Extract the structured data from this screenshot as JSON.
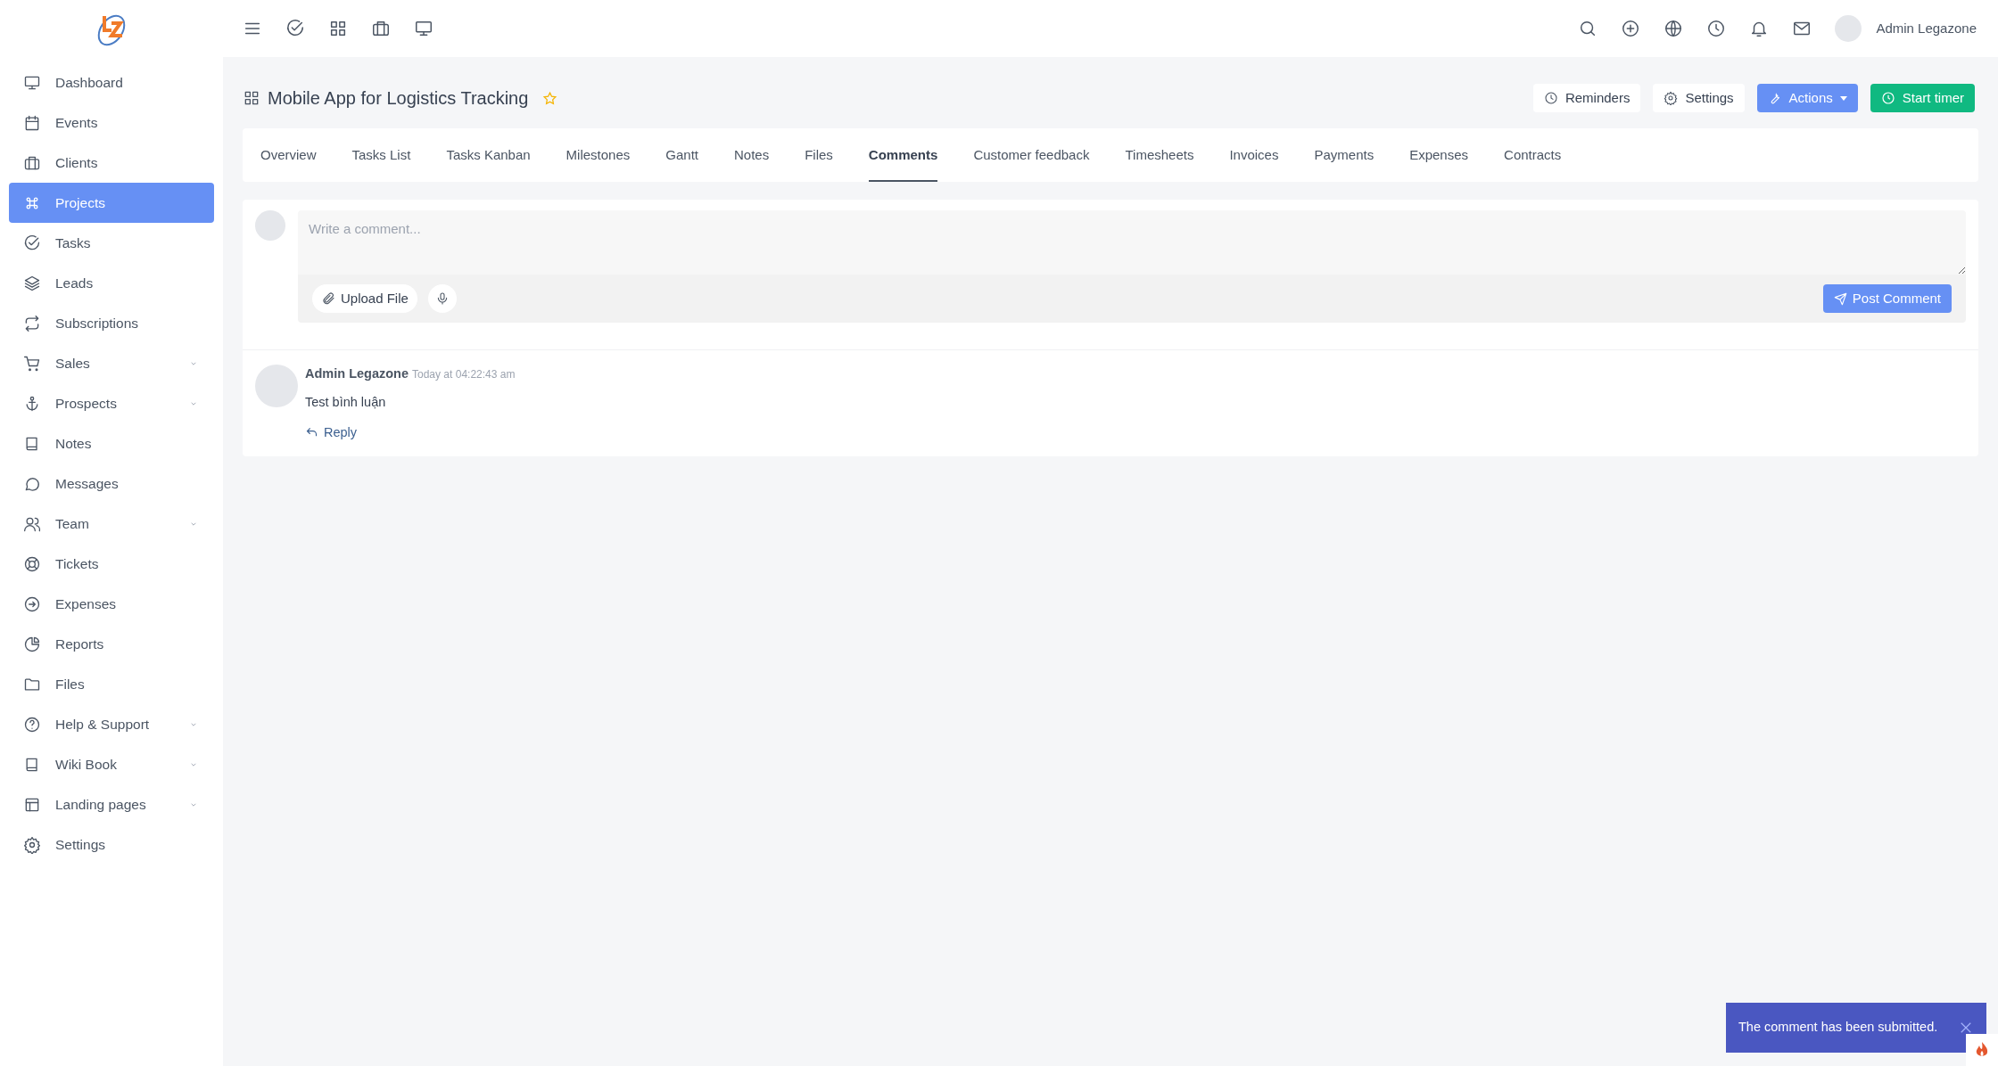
{
  "topbar": {
    "user_name": "Admin Legazone"
  },
  "sidebar": {
    "items": [
      {
        "label": "Dashboard",
        "selected": false,
        "has_submenu": false
      },
      {
        "label": "Events",
        "selected": false,
        "has_submenu": false
      },
      {
        "label": "Clients",
        "selected": false,
        "has_submenu": false
      },
      {
        "label": "Projects",
        "selected": true,
        "has_submenu": false
      },
      {
        "label": "Tasks",
        "selected": false,
        "has_submenu": false
      },
      {
        "label": "Leads",
        "selected": false,
        "has_submenu": false
      },
      {
        "label": "Subscriptions",
        "selected": false,
        "has_submenu": false
      },
      {
        "label": "Sales",
        "selected": false,
        "has_submenu": true
      },
      {
        "label": "Prospects",
        "selected": false,
        "has_submenu": true
      },
      {
        "label": "Notes",
        "selected": false,
        "has_submenu": false
      },
      {
        "label": "Messages",
        "selected": false,
        "has_submenu": false
      },
      {
        "label": "Team",
        "selected": false,
        "has_submenu": true
      },
      {
        "label": "Tickets",
        "selected": false,
        "has_submenu": false
      },
      {
        "label": "Expenses",
        "selected": false,
        "has_submenu": false
      },
      {
        "label": "Reports",
        "selected": false,
        "has_submenu": false
      },
      {
        "label": "Files",
        "selected": false,
        "has_submenu": false
      },
      {
        "label": "Help & Support",
        "selected": false,
        "has_submenu": true
      },
      {
        "label": "Wiki Book",
        "selected": false,
        "has_submenu": true
      },
      {
        "label": "Landing pages",
        "selected": false,
        "has_submenu": true
      },
      {
        "label": "Settings",
        "selected": false,
        "has_submenu": false
      }
    ]
  },
  "page": {
    "title": "Mobile App for Logistics Tracking",
    "starred": true,
    "buttons": [
      {
        "label": "Reminders",
        "kind": "plain"
      },
      {
        "label": "Settings",
        "kind": "plain"
      },
      {
        "label": "Actions",
        "kind": "dropdown"
      },
      {
        "label": "Start timer",
        "kind": "success"
      }
    ]
  },
  "tabs": [
    {
      "label": "Overview",
      "selected": false
    },
    {
      "label": "Tasks List",
      "selected": false
    },
    {
      "label": "Tasks Kanban",
      "selected": false
    },
    {
      "label": "Milestones",
      "selected": false
    },
    {
      "label": "Gantt",
      "selected": false
    },
    {
      "label": "Notes",
      "selected": false
    },
    {
      "label": "Files",
      "selected": false
    },
    {
      "label": "Comments",
      "selected": true
    },
    {
      "label": "Customer feedback",
      "selected": false
    },
    {
      "label": "Timesheets",
      "selected": false
    },
    {
      "label": "Invoices",
      "selected": false
    },
    {
      "label": "Payments",
      "selected": false
    },
    {
      "label": "Expenses",
      "selected": false
    },
    {
      "label": "Contracts",
      "selected": false
    }
  ],
  "composer": {
    "placeholder": "Write a comment...",
    "upload_label": "Upload File",
    "post_label": "Post Comment"
  },
  "comments": [
    {
      "author": "Admin Legazone",
      "time": "Today at 04:22:43 am",
      "text": "Test bình luận",
      "reply_label": "Reply"
    }
  ],
  "toast": {
    "message": "The comment has been submitted."
  }
}
